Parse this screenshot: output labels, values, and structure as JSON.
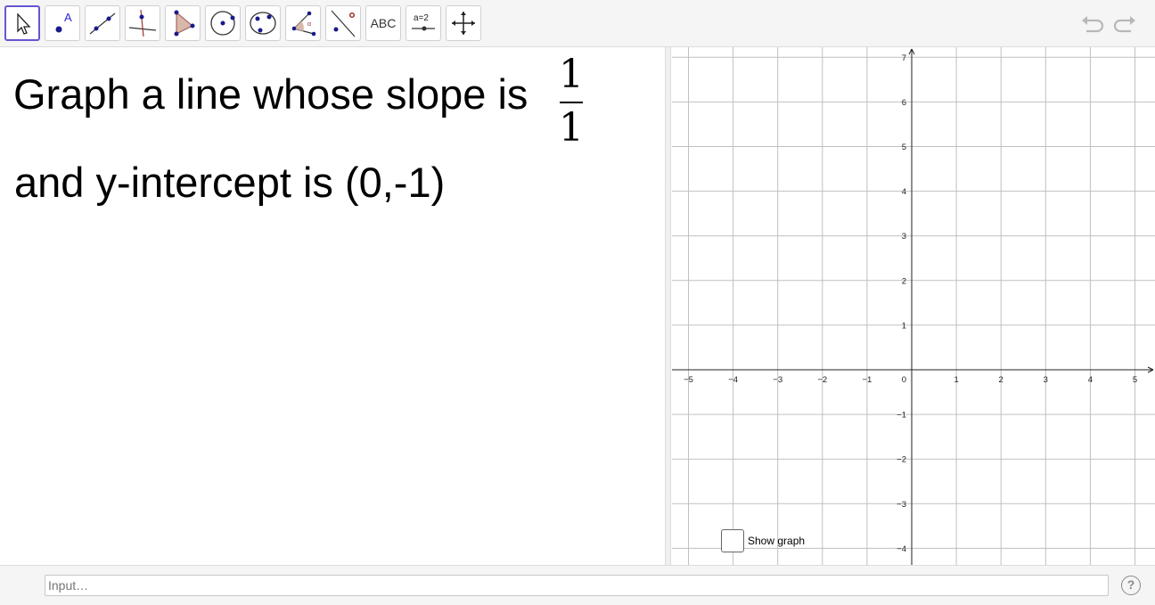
{
  "toolbar": {
    "tools": [
      {
        "name": "move-tool-icon",
        "label": ""
      },
      {
        "name": "point-tool-icon",
        "label": "A"
      },
      {
        "name": "line-tool-icon",
        "label": ""
      },
      {
        "name": "perpendicular-line-tool-icon",
        "label": ""
      },
      {
        "name": "polygon-tool-icon",
        "label": ""
      },
      {
        "name": "circle-tool-icon",
        "label": ""
      },
      {
        "name": "conic-tool-icon",
        "label": ""
      },
      {
        "name": "angle-tool-icon",
        "label": ""
      },
      {
        "name": "reflect-tool-icon",
        "label": ""
      },
      {
        "name": "text-tool-icon",
        "label": "ABC"
      },
      {
        "name": "slider-tool-icon",
        "label": "a=2"
      },
      {
        "name": "move-graphics-tool-icon",
        "label": ""
      }
    ],
    "accent_color": "#6557d2"
  },
  "algebra": {
    "line1": "Graph a line whose slope is",
    "fraction_numerator": "1",
    "fraction_denominator": "1",
    "line2": "and y-intercept is (0,-1)"
  },
  "chart_data": {
    "type": "scatter",
    "x_range": [
      -5.4,
      5.4
    ],
    "y_range": [
      -4.4,
      7.2
    ],
    "x_ticks": [
      "-5",
      "-4",
      "-3",
      "-2",
      "-1",
      "1",
      "2",
      "3",
      "4",
      "5"
    ],
    "y_ticks": [
      "-4",
      "-3",
      "-2",
      "-1",
      "1",
      "2",
      "3",
      "4",
      "5",
      "6",
      "7"
    ],
    "origin_label": "0",
    "grid": true,
    "series": []
  },
  "checkbox": {
    "label": "Show graph",
    "checked": false
  },
  "input_bar": {
    "placeholder": "Input…",
    "help_label": "?"
  }
}
